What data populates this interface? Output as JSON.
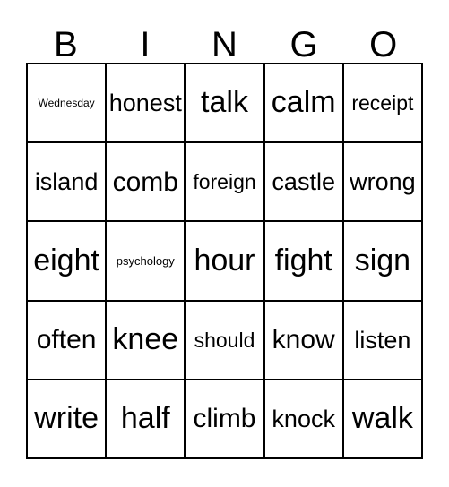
{
  "card": {
    "header_letters": [
      "B",
      "I",
      "N",
      "G",
      "O"
    ],
    "rows": [
      [
        {
          "word": "Wednesday",
          "size": "xxs"
        },
        {
          "word": "honest",
          "size": "l"
        },
        {
          "word": "talk",
          "size": "xxl"
        },
        {
          "word": "calm",
          "size": "xxl"
        },
        {
          "word": "receipt",
          "size": "m"
        }
      ],
      [
        {
          "word": "island",
          "size": "l"
        },
        {
          "word": "comb",
          "size": "xl"
        },
        {
          "word": "foreign",
          "size": "m"
        },
        {
          "word": "castle",
          "size": "l"
        },
        {
          "word": "wrong",
          "size": "l"
        }
      ],
      [
        {
          "word": "eight",
          "size": "xxl"
        },
        {
          "word": "psychology",
          "size": "xs"
        },
        {
          "word": "hour",
          "size": "xxl"
        },
        {
          "word": "fight",
          "size": "xxl"
        },
        {
          "word": "sign",
          "size": "xxl"
        }
      ],
      [
        {
          "word": "often",
          "size": "xl"
        },
        {
          "word": "knee",
          "size": "xxl"
        },
        {
          "word": "should",
          "size": "m"
        },
        {
          "word": "know",
          "size": "xl"
        },
        {
          "word": "listen",
          "size": "l"
        }
      ],
      [
        {
          "word": "write",
          "size": "xxl"
        },
        {
          "word": "half",
          "size": "xxl"
        },
        {
          "word": "climb",
          "size": "xl"
        },
        {
          "word": "knock",
          "size": "l"
        },
        {
          "word": "walk",
          "size": "xxl"
        }
      ]
    ],
    "colors": {
      "grid_line": "#000000",
      "text": "#000000",
      "background": "#ffffff"
    }
  }
}
